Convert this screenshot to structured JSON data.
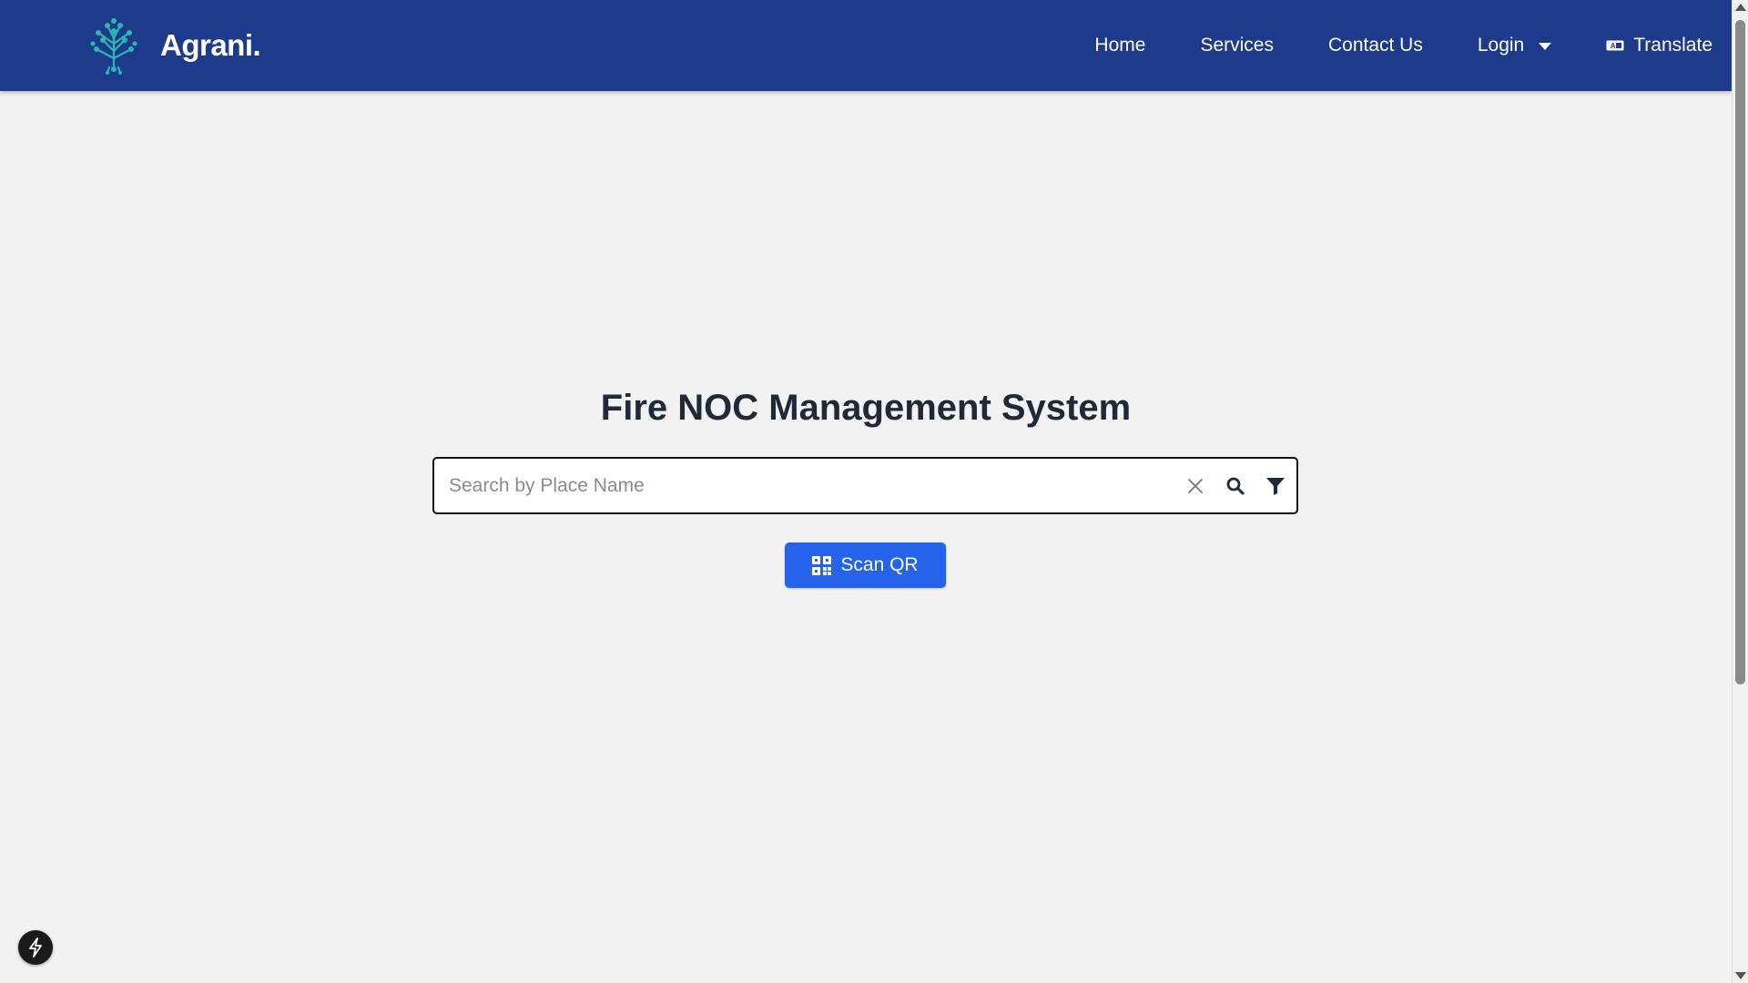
{
  "header": {
    "brand_name": "Agrani.",
    "nav": {
      "home": "Home",
      "services": "Services",
      "contact": "Contact Us",
      "login": "Login",
      "translate": "Translate"
    }
  },
  "main": {
    "title": "Fire NOC Management System",
    "search": {
      "placeholder": "Search by Place Name",
      "value": ""
    },
    "scan_button_label": "Scan QR"
  },
  "icons": {
    "logo": "tree-circuit-logo",
    "login_dropdown": "caret-down-icon",
    "translate": "translate-icon",
    "clear": "close-icon",
    "search": "search-icon",
    "filter": "filter-icon",
    "qr": "qr-code-icon",
    "floating": "bolt-icon"
  },
  "colors": {
    "header_bg": "#1e3a8a",
    "page_bg": "#f2f2f2",
    "primary_button": "#2563eb",
    "logo_accent": "#2cb8b0"
  }
}
